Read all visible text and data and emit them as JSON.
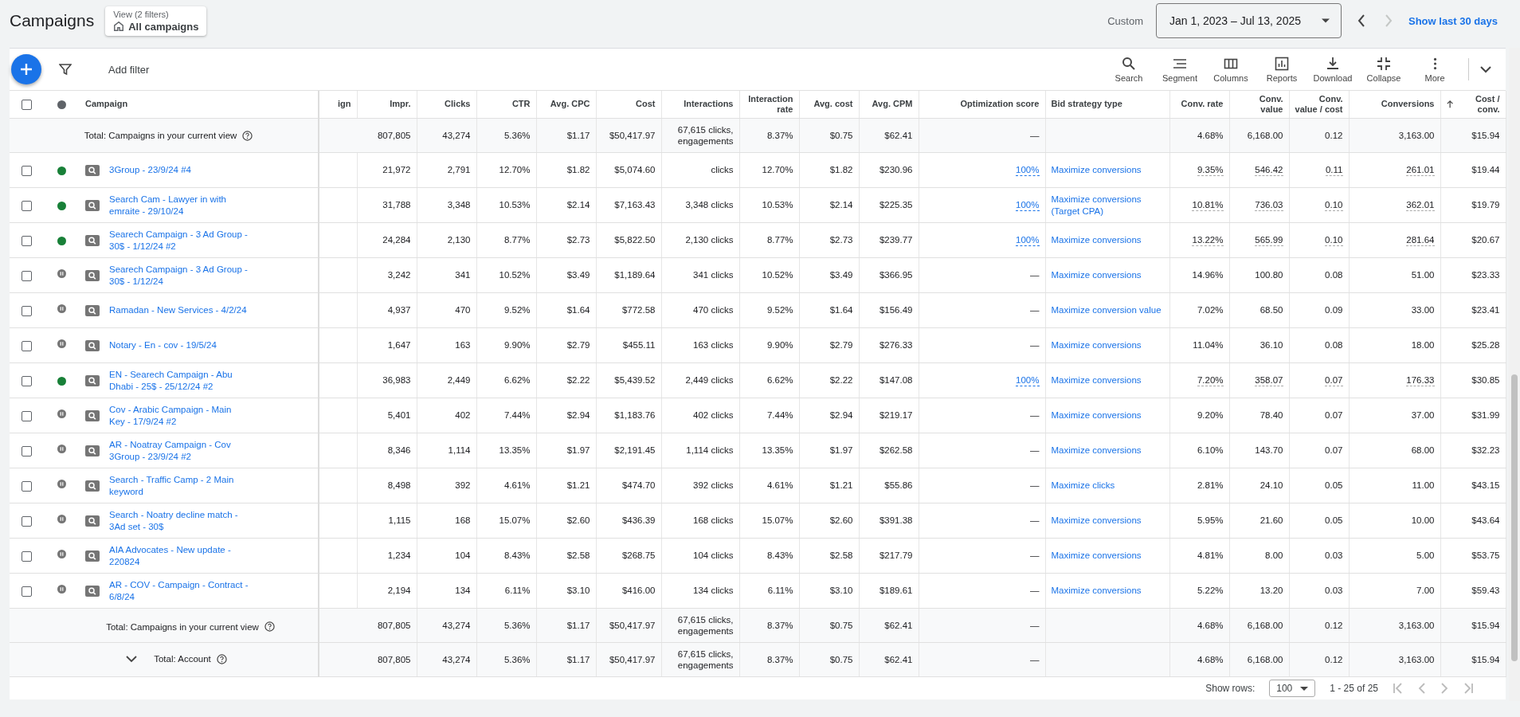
{
  "page_title": "Campaigns",
  "view_chip": {
    "caption": "View (2 filters)",
    "label": "All campaigns"
  },
  "date_range": {
    "label": "Custom",
    "value": "Jan 1, 2023 – Jul 13, 2025",
    "next_disabled": true,
    "link": "Show last 30 days"
  },
  "toolbar": {
    "add_filter": "Add filter",
    "tools": [
      {
        "kind": "search",
        "label": "Search"
      },
      {
        "kind": "segment",
        "label": "Segment"
      },
      {
        "kind": "columns",
        "label": "Columns"
      },
      {
        "kind": "reports",
        "label": "Reports"
      },
      {
        "kind": "download",
        "label": "Download"
      },
      {
        "kind": "collapse",
        "label": "Collapse"
      },
      {
        "kind": "more",
        "label": "More"
      }
    ]
  },
  "table": {
    "select_all": {
      "checked": false
    },
    "columns": [
      {
        "label": "Campaign",
        "kind": "name",
        "sorted": false
      },
      {
        "label": "ign",
        "kind": "blank",
        "sorted": false
      },
      {
        "label": "Impr.",
        "kind": "metric",
        "sorted": false
      },
      {
        "label": "Clicks",
        "kind": "metric",
        "sorted": false
      },
      {
        "label": "CTR",
        "kind": "metric",
        "sorted": false
      },
      {
        "label": "Avg. CPC",
        "kind": "metric",
        "sorted": false
      },
      {
        "label": "Cost",
        "kind": "metric",
        "sorted": false
      },
      {
        "label": "Interactions",
        "kind": "metric",
        "sorted": false
      },
      {
        "label": "Interaction rate",
        "kind": "metric",
        "sorted": false
      },
      {
        "label": "Avg. cost",
        "kind": "metric",
        "sorted": false
      },
      {
        "label": "Avg. CPM",
        "kind": "metric",
        "sorted": false
      },
      {
        "label": "Optimization score",
        "kind": "score",
        "sorted": false
      },
      {
        "label": "Bid strategy type",
        "kind": "strategy",
        "sorted": false
      },
      {
        "label": "Conv. rate",
        "kind": "conv",
        "sorted": false
      },
      {
        "label": "Conv. value",
        "kind": "conv",
        "sorted": false
      },
      {
        "label": "Conv. value / cost",
        "kind": "conv",
        "sorted": false
      },
      {
        "label": "Conversions",
        "kind": "conv",
        "sorted": false
      },
      {
        "label": "Cost / conv.",
        "kind": "metric",
        "sorted": true
      }
    ],
    "top_total": {
      "label": "Total: Campaigns in your current view",
      "values": [
        "807,805",
        "43,274",
        "5.36%",
        "$1.17",
        "$50,417.97",
        "67,615 clicks, engagements",
        "8.37%",
        "$0.75",
        "$62.41",
        "—",
        "4.68%",
        "6,168.00",
        "0.12",
        "3,163.00",
        "$15.94"
      ]
    },
    "rows": [
      {
        "checked": false,
        "paused": false,
        "name": "3Group - 23/9/24 #4",
        "values": [
          "21,972",
          "2,791",
          "12.70%",
          "$1.82",
          "$5,074.60",
          "clicks",
          "12.70%",
          "$1.82",
          "$230.96",
          "100%",
          "Maximize conversions",
          "9.35%",
          "546.42",
          "0.11",
          "261.01",
          "$19.44"
        ]
      },
      {
        "checked": false,
        "paused": false,
        "name": "Search Cam - Lawyer in with emraite - 29/10/24",
        "values": [
          "31,788",
          "3,348",
          "10.53%",
          "$2.14",
          "$7,163.43",
          "3,348 clicks",
          "10.53%",
          "$2.14",
          "$225.35",
          "100%",
          "Maximize conversions (Target CPA)",
          "10.81%",
          "736.03",
          "0.10",
          "362.01",
          "$19.79"
        ]
      },
      {
        "checked": false,
        "paused": false,
        "name": "Searech Campaign - 3 Ad Group - 30$ - 1/12/24 #2",
        "values": [
          "24,284",
          "2,130",
          "8.77%",
          "$2.73",
          "$5,822.50",
          "2,130 clicks",
          "8.77%",
          "$2.73",
          "$239.77",
          "100%",
          "Maximize conversions",
          "13.22%",
          "565.99",
          "0.10",
          "281.64",
          "$20.67"
        ]
      },
      {
        "checked": false,
        "paused": true,
        "name": "Searech Campaign - 3 Ad Group - 30$ - 1/12/24",
        "values": [
          "3,242",
          "341",
          "10.52%",
          "$3.49",
          "$1,189.64",
          "341 clicks",
          "10.52%",
          "$3.49",
          "$366.95",
          "—",
          "Maximize conversions",
          "14.96%",
          "100.80",
          "0.08",
          "51.00",
          "$23.33"
        ]
      },
      {
        "checked": false,
        "paused": true,
        "name": "Ramadan - New Services - 4/2/24",
        "values": [
          "4,937",
          "470",
          "9.52%",
          "$1.64",
          "$772.58",
          "470 clicks",
          "9.52%",
          "$1.64",
          "$156.49",
          "—",
          "Maximize conversion value",
          "7.02%",
          "68.50",
          "0.09",
          "33.00",
          "$23.41"
        ]
      },
      {
        "checked": false,
        "paused": true,
        "name": "Notary - En - cov - 19/5/24",
        "values": [
          "1,647",
          "163",
          "9.90%",
          "$2.79",
          "$455.11",
          "163 clicks",
          "9.90%",
          "$2.79",
          "$276.33",
          "—",
          "Maximize conversions",
          "11.04%",
          "36.10",
          "0.08",
          "18.00",
          "$25.28"
        ]
      },
      {
        "checked": false,
        "paused": false,
        "name": "EN - Searech Campaign - Abu Dhabi - 25$ - 25/12/24 #2",
        "values": [
          "36,983",
          "2,449",
          "6.62%",
          "$2.22",
          "$5,439.52",
          "2,449 clicks",
          "6.62%",
          "$2.22",
          "$147.08",
          "100%",
          "Maximize conversions",
          "7.20%",
          "358.07",
          "0.07",
          "176.33",
          "$30.85"
        ]
      },
      {
        "checked": false,
        "paused": true,
        "name": "Cov - Arabic Campaign - Main Key - 17/9/24 #2",
        "values": [
          "5,401",
          "402",
          "7.44%",
          "$2.94",
          "$1,183.76",
          "402 clicks",
          "7.44%",
          "$2.94",
          "$219.17",
          "—",
          "Maximize conversions",
          "9.20%",
          "78.40",
          "0.07",
          "37.00",
          "$31.99"
        ]
      },
      {
        "checked": false,
        "paused": true,
        "name": "AR - Noatray Campaign - Cov 3Group - 23/9/24 #2",
        "values": [
          "8,346",
          "1,114",
          "13.35%",
          "$1.97",
          "$2,191.45",
          "1,114 clicks",
          "13.35%",
          "$1.97",
          "$262.58",
          "—",
          "Maximize conversions",
          "6.10%",
          "143.70",
          "0.07",
          "68.00",
          "$32.23"
        ]
      },
      {
        "checked": false,
        "paused": true,
        "name": "Search - Traffic Camp - 2 Main keyword",
        "values": [
          "8,498",
          "392",
          "4.61%",
          "$1.21",
          "$474.70",
          "392 clicks",
          "4.61%",
          "$1.21",
          "$55.86",
          "—",
          "Maximize clicks",
          "2.81%",
          "24.10",
          "0.05",
          "11.00",
          "$43.15"
        ]
      },
      {
        "checked": false,
        "paused": true,
        "name": "Search - Noatry decline match - 3Ad set - 30$",
        "values": [
          "1,115",
          "168",
          "15.07%",
          "$2.60",
          "$436.39",
          "168 clicks",
          "15.07%",
          "$2.60",
          "$391.38",
          "—",
          "Maximize conversions",
          "5.95%",
          "21.60",
          "0.05",
          "10.00",
          "$43.64"
        ]
      },
      {
        "checked": false,
        "paused": true,
        "name": "AIA Advocates - New update - 220824",
        "values": [
          "1,234",
          "104",
          "8.43%",
          "$2.58",
          "$268.75",
          "104 clicks",
          "8.43%",
          "$2.58",
          "$217.79",
          "—",
          "Maximize conversions",
          "4.81%",
          "8.00",
          "0.03",
          "5.00",
          "$53.75"
        ]
      },
      {
        "checked": false,
        "paused": true,
        "name": "AR - COV - Campaign - Contract - 6/8/24",
        "values": [
          "2,194",
          "134",
          "6.11%",
          "$3.10",
          "$416.00",
          "134 clicks",
          "6.11%",
          "$3.10",
          "$189.61",
          "—",
          "Maximize conversions",
          "5.22%",
          "13.20",
          "0.03",
          "7.00",
          "$59.43"
        ]
      }
    ],
    "bottom_totals": [
      {
        "label": "Total: Campaigns in your current view",
        "expandable": false,
        "values": [
          "807,805",
          "43,274",
          "5.36%",
          "$1.17",
          "$50,417.97",
          "67,615 clicks, engagements",
          "8.37%",
          "$0.75",
          "$62.41",
          "—",
          "4.68%",
          "6,168.00",
          "0.12",
          "3,163.00",
          "$15.94"
        ]
      },
      {
        "label": "Total: Account",
        "expandable": true,
        "values": [
          "807,805",
          "43,274",
          "5.36%",
          "$1.17",
          "$50,417.97",
          "67,615 clicks, engagements",
          "8.37%",
          "$0.75",
          "$62.41",
          "—",
          "4.68%",
          "6,168.00",
          "0.12",
          "3,163.00",
          "$15.94"
        ]
      }
    ]
  },
  "pagination": {
    "label": "Show rows:",
    "rows_per_page": "100",
    "range": "1 - 25 of 25"
  }
}
